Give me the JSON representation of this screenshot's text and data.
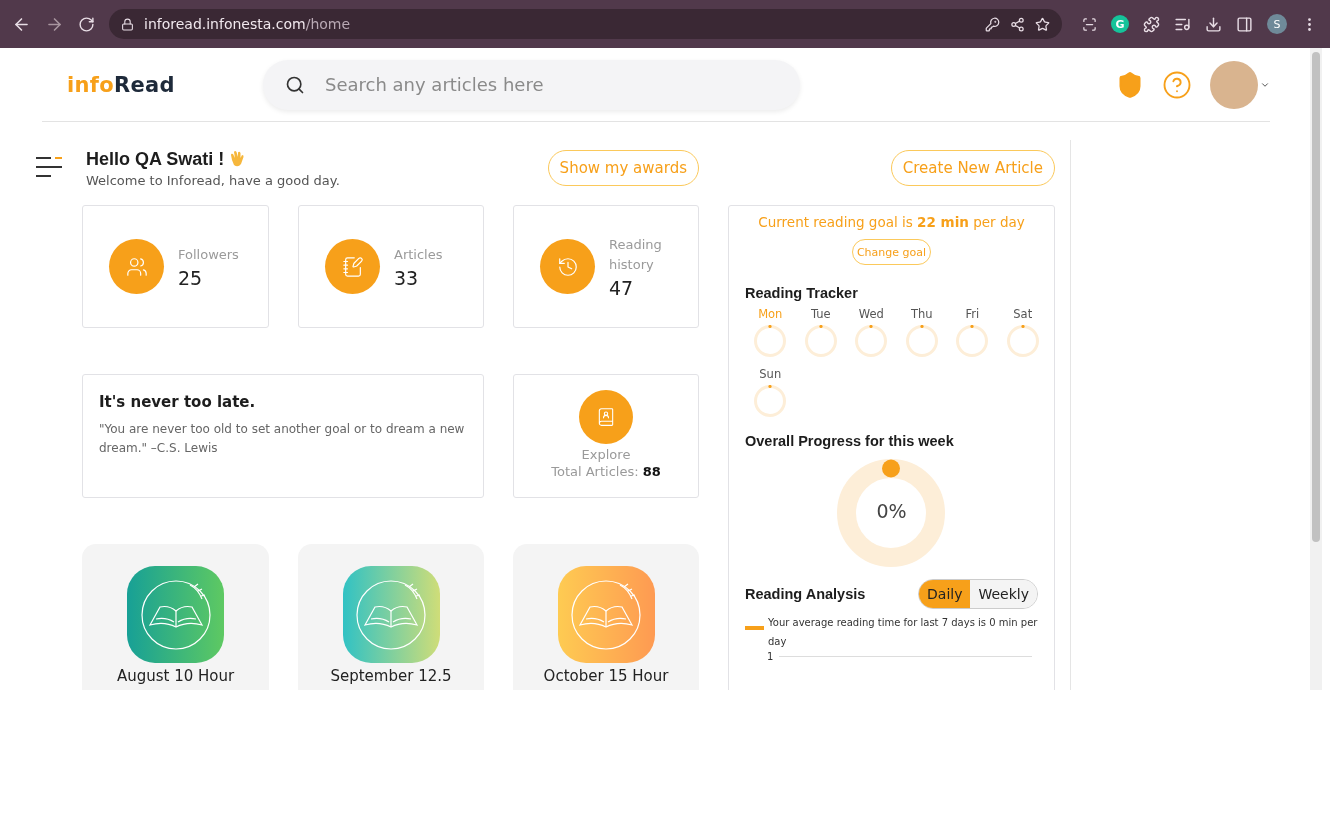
{
  "browser": {
    "url_host": "inforead.infonesta.com",
    "url_path": "/home",
    "extension_badge": "G",
    "profile_initial": "S"
  },
  "header": {
    "logo": [
      "info",
      "Read"
    ],
    "search": {
      "placeholder": "Search any articles here"
    }
  },
  "greeting": {
    "title": "Hello QA Swati !",
    "subtitle": "Welcome to Inforead, have a good day."
  },
  "buttons": [
    "Show my awards",
    "Create New Article"
  ],
  "stats": [
    {
      "kind": "followers",
      "label": "Followers",
      "value": "25"
    },
    {
      "kind": "articles",
      "label": "Articles",
      "value": "33"
    },
    {
      "kind": "history",
      "label": "Reading history",
      "value": "47"
    }
  ],
  "quote": {
    "title": "It's never too late.",
    "text": "\"You are never too old to set another goal or to dream a new dream.\" –C.S. Lewis"
  },
  "explore": {
    "label": "Explore",
    "total_label": "Total Articles:",
    "total": "88"
  },
  "awards": [
    {
      "kind": "green",
      "label": "August 10 Hour"
    },
    {
      "kind": "teal",
      "label": "September 12.5"
    },
    {
      "kind": "orange",
      "label": "October 15 Hour"
    }
  ],
  "goal": {
    "text": "Current reading goal is **22 min** per day",
    "button": "Change goal"
  },
  "tracker": {
    "title": "Reading Tracker",
    "days": [
      {
        "label": "Mon",
        "selected": true
      },
      {
        "label": "Tue",
        "selected": false
      },
      {
        "label": "Wed",
        "selected": false
      },
      {
        "label": "Thu",
        "selected": false
      },
      {
        "label": "Fri",
        "selected": false
      },
      {
        "label": "Sat",
        "selected": false
      },
      {
        "label": "Sun",
        "selected": false
      }
    ]
  },
  "progress": {
    "title": "Overall Progress for this week",
    "reading": "0%"
  },
  "analysis": {
    "title": "Reading Analysis",
    "tabs": [
      {
        "label": "Daily",
        "selected": true
      },
      {
        "label": "Weekly",
        "selected": false
      }
    ],
    "legend": "Your average reading time for last 7 days is 0 min per day",
    "y_tick": "1"
  }
}
